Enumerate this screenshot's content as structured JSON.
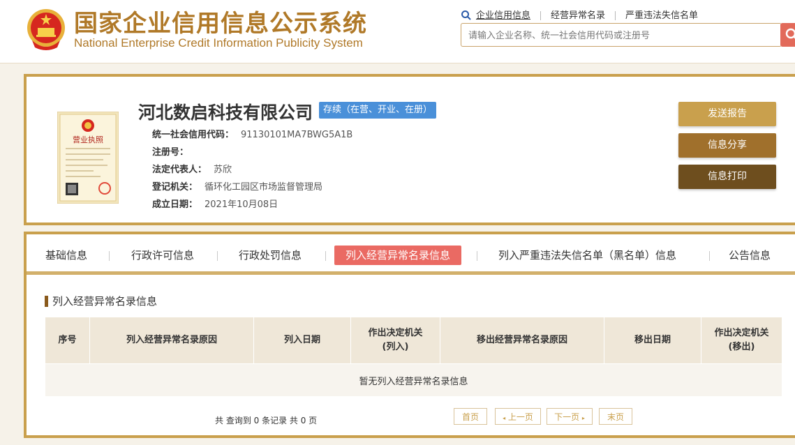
{
  "header": {
    "site_title": "国家企业信用信息公示系统",
    "site_subtitle": "National Enterprise Credit Information Publicity System",
    "nav": [
      "企业信用信息",
      "经营异常名录",
      "严重违法失信名单"
    ],
    "search_placeholder": "请输入企业名称、统一社会信用代码或注册号"
  },
  "company": {
    "name": "河北数启科技有限公司",
    "status": "存续（在营、开业、在册）",
    "fields": [
      {
        "label": "统一社会信用代码：",
        "value": "91130101MA7BWG5A1B"
      },
      {
        "label": "注册号：",
        "value": ""
      },
      {
        "label": "法定代表人：",
        "value": "苏欣"
      },
      {
        "label": "登记机关：",
        "value": "循环化工园区市场监督管理局"
      },
      {
        "label": "成立日期：",
        "value": "2021年10月08日"
      }
    ],
    "license_image": {
      "title": "营业执照"
    },
    "actions": [
      {
        "label": "发送报告",
        "color": "#c9a04d"
      },
      {
        "label": "信息分享",
        "color": "#a0702c"
      },
      {
        "label": "信息打印",
        "color": "#6e4e1e"
      }
    ]
  },
  "tabs": [
    {
      "label": "基础信息",
      "active": false
    },
    {
      "label": "行政许可信息",
      "active": false
    },
    {
      "label": "行政处罚信息",
      "active": false
    },
    {
      "label": "列入经营异常名录信息",
      "active": true
    },
    {
      "label": "列入严重违法失信名单（黑名单）信息",
      "active": false
    },
    {
      "label": "公告信息",
      "active": false
    }
  ],
  "section": {
    "title": "列入经营异常名录信息",
    "columns": [
      "序号",
      "列入经营异常名录原因",
      "列入日期",
      "作出决定机关\n(列入)",
      "移出经营异常名录原因",
      "移出日期",
      "作出决定机关\n(移出)"
    ],
    "empty_text": "暂无列入经营异常名录信息"
  },
  "pager": {
    "summary": "共 查询到 0 条记录 共 0 页",
    "first": "首页",
    "prev": "上一页",
    "next": "下一页",
    "last": "末页"
  },
  "colors": {
    "brand_gold": "#b07928",
    "border_gold": "#c9a04d",
    "active_tab": "#ea6a63",
    "status_badge": "#4a90d9"
  }
}
